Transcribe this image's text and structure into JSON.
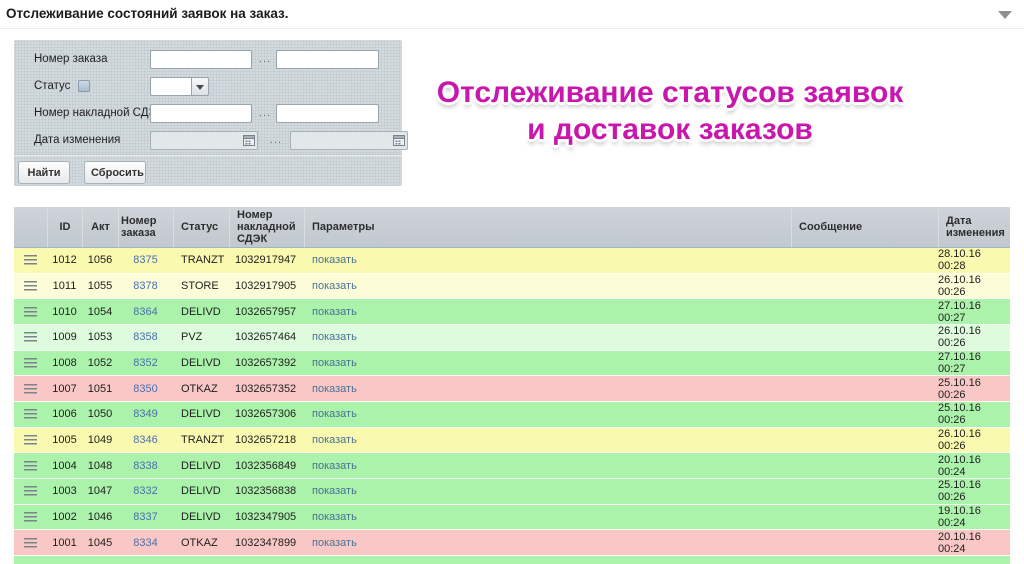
{
  "page": {
    "title": "Отслеживание состояний заявок на заказ.",
    "collapse_icon": "triangle-down"
  },
  "banner": {
    "line1": "Отслеживание статусов заявок",
    "line2": "и доставок заказов",
    "color": "#c917ae"
  },
  "filter": {
    "order_number_label": "Номер заказа",
    "status_label": "Статус",
    "invoice_label": "Номер накладной СДЭК",
    "date_label": "Дата изменения",
    "range_separator": "...",
    "order_from_value": "",
    "order_to_value": "",
    "status_value": "",
    "invoice_from_value": "",
    "invoice_to_value": "",
    "date_from_value": "",
    "date_to_value": "",
    "find_button": "Найти",
    "reset_button": "Сбросить"
  },
  "table": {
    "columns": [
      "",
      "ID",
      "Акт",
      "Номер заказа",
      "Статус",
      "Номер накладной СДЭК",
      "Параметры",
      "Сообщение",
      "Дата изменения"
    ],
    "show_link_label": "показать",
    "status_colors": {
      "yellow": "#f9f9b0",
      "cream": "#fcfcd8",
      "green": "#abf3ab",
      "palegreen": "#defbde",
      "pink": "#f9c8c6"
    },
    "rows": [
      {
        "id": "1012",
        "act": "1056",
        "order": "8375",
        "status": "TRANZT",
        "invoice": "1032917947",
        "message": "",
        "date": "28.10.16 00:28",
        "color": "yellow"
      },
      {
        "id": "1011",
        "act": "1055",
        "order": "8378",
        "status": "STORE",
        "invoice": "1032917905",
        "message": "",
        "date": "26.10.16 00:26",
        "color": "cream"
      },
      {
        "id": "1010",
        "act": "1054",
        "order": "8364",
        "status": "DELIVD",
        "invoice": "1032657957",
        "message": "",
        "date": "27.10.16 00:27",
        "color": "green"
      },
      {
        "id": "1009",
        "act": "1053",
        "order": "8358",
        "status": "PVZ",
        "invoice": "1032657464",
        "message": "",
        "date": "26.10.16 00:26",
        "color": "palegreen"
      },
      {
        "id": "1008",
        "act": "1052",
        "order": "8352",
        "status": "DELIVD",
        "invoice": "1032657392",
        "message": "",
        "date": "27.10.16 00:27",
        "color": "green"
      },
      {
        "id": "1007",
        "act": "1051",
        "order": "8350",
        "status": "OTKAZ",
        "invoice": "1032657352",
        "message": "",
        "date": "25.10.16 00:26",
        "color": "pink"
      },
      {
        "id": "1006",
        "act": "1050",
        "order": "8349",
        "status": "DELIVD",
        "invoice": "1032657306",
        "message": "",
        "date": "25.10.16 00:26",
        "color": "green"
      },
      {
        "id": "1005",
        "act": "1049",
        "order": "8346",
        "status": "TRANZT",
        "invoice": "1032657218",
        "message": "",
        "date": "26.10.16 00:26",
        "color": "yellow"
      },
      {
        "id": "1004",
        "act": "1048",
        "order": "8338",
        "status": "DELIVD",
        "invoice": "1032356849",
        "message": "",
        "date": "20.10.16 00:24",
        "color": "green"
      },
      {
        "id": "1003",
        "act": "1047",
        "order": "8332",
        "status": "DELIVD",
        "invoice": "1032356838",
        "message": "",
        "date": "25.10.16 00:26",
        "color": "green"
      },
      {
        "id": "1002",
        "act": "1046",
        "order": "8337",
        "status": "DELIVD",
        "invoice": "1032347905",
        "message": "",
        "date": "19.10.16 00:24",
        "color": "green"
      },
      {
        "id": "1001",
        "act": "1045",
        "order": "8334",
        "status": "OTKAZ",
        "invoice": "1032347899",
        "message": "",
        "date": "20.10.16 00:24",
        "color": "pink"
      }
    ]
  }
}
